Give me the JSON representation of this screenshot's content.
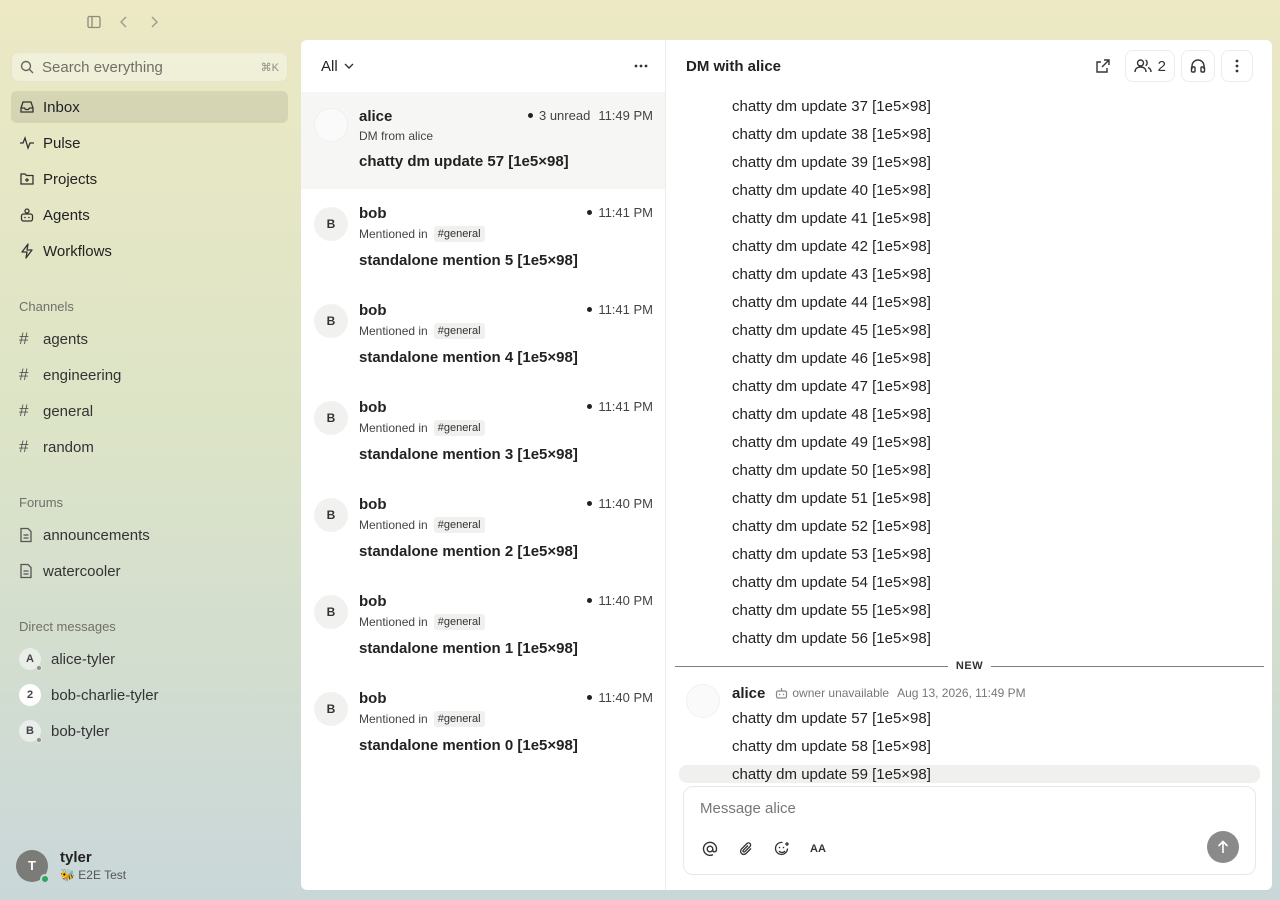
{
  "sidebar": {
    "search": {
      "placeholder": "Search everything",
      "shortcut": "⌘K"
    },
    "nav": [
      {
        "label": "Inbox",
        "icon": "inbox-icon",
        "active": true
      },
      {
        "label": "Pulse",
        "icon": "pulse-icon"
      },
      {
        "label": "Projects",
        "icon": "projects-icon"
      },
      {
        "label": "Agents",
        "icon": "agents-icon"
      },
      {
        "label": "Workflows",
        "icon": "workflows-icon"
      }
    ],
    "channels_title": "Channels",
    "channels": [
      "agents",
      "engineering",
      "general",
      "random"
    ],
    "forums_title": "Forums",
    "forums": [
      "announcements",
      "watercooler"
    ],
    "dms_title": "Direct messages",
    "dms": [
      {
        "avatar": "A",
        "label": "alice-tyler"
      },
      {
        "avatar": "2",
        "label": "bob-charlie-tyler"
      },
      {
        "avatar": "B",
        "label": "bob-tyler"
      }
    ],
    "user": {
      "initial": "T",
      "name": "tyler",
      "status": "🐝 E2E Test"
    }
  },
  "inbox": {
    "filter": "All",
    "items": [
      {
        "name": "alice",
        "unread": "3 unread",
        "time": "11:49 PM",
        "sub": "DM from alice",
        "tag": "",
        "preview": "chatty dm update 57 [1e5×98]"
      },
      {
        "avatar": "B",
        "name": "bob",
        "time": "11:41 PM",
        "sub": "Mentioned in",
        "tag": "#general",
        "preview": "standalone mention 5 [1e5×98]"
      },
      {
        "avatar": "B",
        "name": "bob",
        "time": "11:41 PM",
        "sub": "Mentioned in",
        "tag": "#general",
        "preview": "standalone mention 4 [1e5×98]"
      },
      {
        "avatar": "B",
        "name": "bob",
        "time": "11:41 PM",
        "sub": "Mentioned in",
        "tag": "#general",
        "preview": "standalone mention 3 [1e5×98]"
      },
      {
        "avatar": "B",
        "name": "bob",
        "time": "11:40 PM",
        "sub": "Mentioned in",
        "tag": "#general",
        "preview": "standalone mention 2 [1e5×98]"
      },
      {
        "avatar": "B",
        "name": "bob",
        "time": "11:40 PM",
        "sub": "Mentioned in",
        "tag": "#general",
        "preview": "standalone mention 1 [1e5×98]"
      },
      {
        "avatar": "B",
        "name": "bob",
        "time": "11:40 PM",
        "sub": "Mentioned in",
        "tag": "#general",
        "preview": "standalone mention 0 [1e5×98]"
      }
    ]
  },
  "conversation": {
    "title": "DM with alice",
    "member_count": "2",
    "earlier_messages": [
      "chatty dm update 37 [1e5×98]",
      "chatty dm update 38 [1e5×98]",
      "chatty dm update 39 [1e5×98]",
      "chatty dm update 40 [1e5×98]",
      "chatty dm update 41 [1e5×98]",
      "chatty dm update 42 [1e5×98]",
      "chatty dm update 43 [1e5×98]",
      "chatty dm update 44 [1e5×98]",
      "chatty dm update 45 [1e5×98]",
      "chatty dm update 46 [1e5×98]",
      "chatty dm update 47 [1e5×98]",
      "chatty dm update 48 [1e5×98]",
      "chatty dm update 49 [1e5×98]",
      "chatty dm update 50 [1e5×98]",
      "chatty dm update 51 [1e5×98]",
      "chatty dm update 52 [1e5×98]",
      "chatty dm update 53 [1e5×98]",
      "chatty dm update 54 [1e5×98]",
      "chatty dm update 55 [1e5×98]",
      "chatty dm update 56 [1e5×98]"
    ],
    "divider_label": "NEW",
    "author": {
      "name": "alice",
      "badge": "owner unavailable",
      "timestamp": "Aug 13, 2026, 11:49 PM"
    },
    "new_messages": [
      "chatty dm update 57 [1e5×98]",
      "chatty dm update 58 [1e5×98]",
      "chatty dm update 59 [1e5×98]"
    ],
    "composer": {
      "placeholder": "Message alice",
      "format_label": "AA"
    }
  }
}
